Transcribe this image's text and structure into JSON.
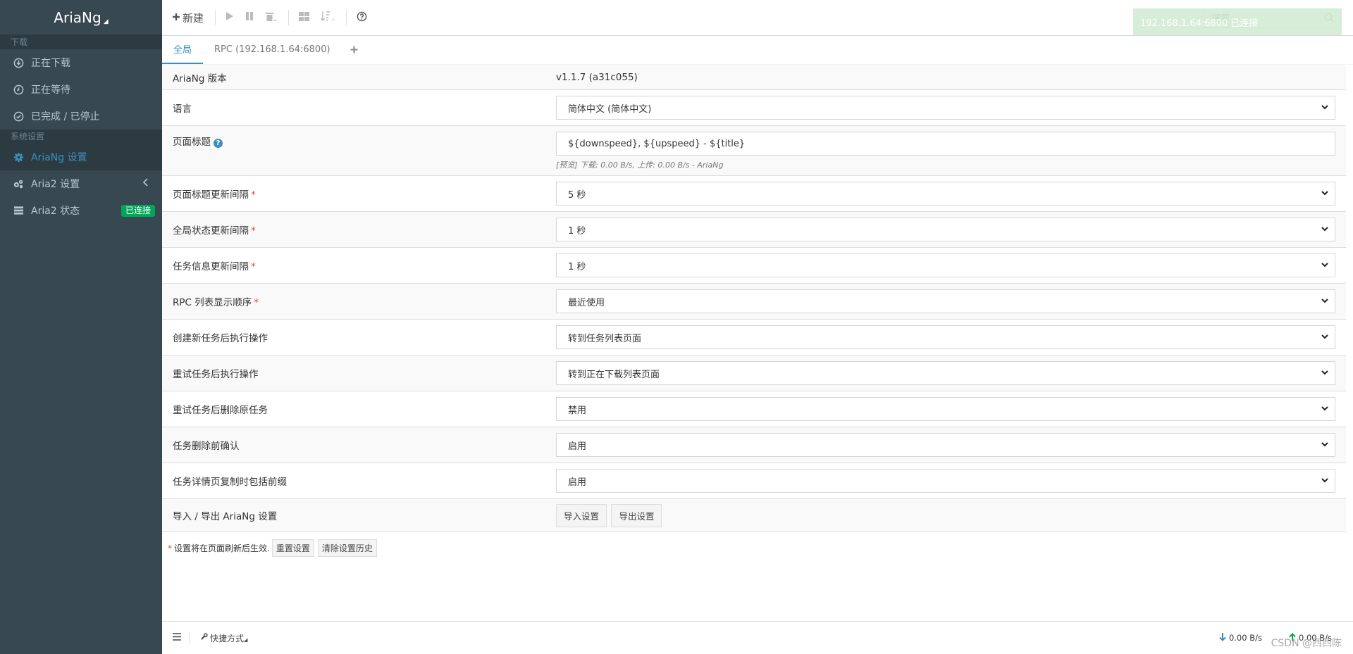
{
  "app": {
    "name": "AriaNg"
  },
  "sidebar": {
    "download_header": "下载",
    "downloading": "正在下载",
    "waiting": "正在等待",
    "stopped": "已完成 / 已停止",
    "settings_header": "系统设置",
    "ariang_settings": "AriaNg 设置",
    "aria2_settings": "Aria2 设置",
    "aria2_status": "Aria2 状态",
    "status_badge": "已连接"
  },
  "toolbar": {
    "new_label": "新建"
  },
  "search": {
    "placeholder": "搜索"
  },
  "toast": {
    "text": "192.168.1.64:6800 已连接"
  },
  "tabs": {
    "global": "全局",
    "rpc": "RPC (192.168.1.64:6800)"
  },
  "settings": {
    "version_label": "AriaNg 版本",
    "version_value": "v1.1.7 (a31c055)",
    "language_label": "语言",
    "language_value": "简体中文 (简体中文)",
    "title_label": "页面标题",
    "title_value": "${downspeed}, ${upspeed} - ${title}",
    "title_preview": "[预览] 下载: 0.00 B/s, 上传: 0.00 B/s - AriaNg",
    "title_interval_label": "页面标题更新间隔",
    "title_interval_value": "5 秒",
    "global_interval_label": "全局状态更新间隔",
    "global_interval_value": "1 秒",
    "task_interval_label": "任务信息更新间隔",
    "task_interval_value": "1 秒",
    "rpc_order_label": "RPC 列表显示顺序",
    "rpc_order_value": "最近使用",
    "after_create_label": "创建新任务后执行操作",
    "after_create_value": "转到任务列表页面",
    "after_retry_label": "重试任务后执行操作",
    "after_retry_value": "转到正在下载列表页面",
    "remove_after_retry_label": "重试任务后删除原任务",
    "remove_after_retry_value": "禁用",
    "confirm_delete_label": "任务删除前确认",
    "confirm_delete_value": "启用",
    "copy_prefix_label": "任务详情页复制时包括前缀",
    "copy_prefix_value": "启用",
    "import_export_label": "导入 / 导出 AriaNg 设置",
    "import_button": "导入设置",
    "export_button": "导出设置"
  },
  "footer": {
    "asterisk": "*",
    "note": "设置将在页面刷新后生效.",
    "reset_button": "重置设置",
    "clear_history_button": "清除设置历史"
  },
  "statusbar": {
    "shortcut_label": "快捷方式",
    "download_speed": "0.00 B/s",
    "upload_speed": "0.00 B/s",
    "watermark": "CSDN @西西陈"
  },
  "colors": {
    "sidebar_bg": "#374850",
    "accent": "#3c8dbc",
    "badge": "#00a65a",
    "required": "#dd4b39"
  }
}
